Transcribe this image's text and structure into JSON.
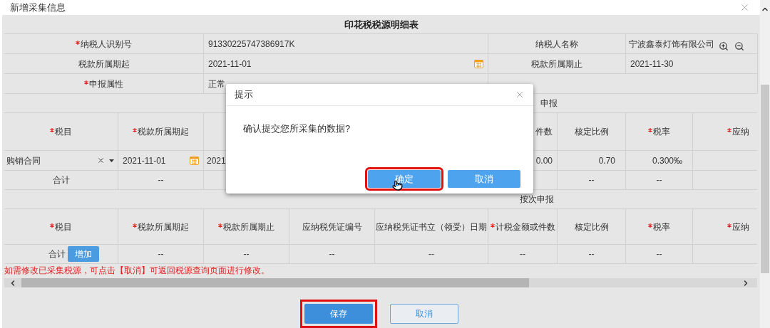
{
  "window": {
    "title": "新增采集信息"
  },
  "info": {
    "title": "印花税税源明细表",
    "rows": [
      {
        "cells": [
          {
            "kind": "label",
            "text": "纳税人识别号",
            "required": true
          },
          {
            "kind": "text",
            "text": "91330225747386917K"
          },
          {
            "kind": "label",
            "text": "纳税人名称",
            "required": false
          },
          {
            "kind": "zoom",
            "text": "宁波鑫泰灯饰有限公司"
          }
        ]
      },
      {
        "cells": [
          {
            "kind": "label",
            "text": "税款所属期起",
            "required": false
          },
          {
            "kind": "date",
            "text": "2021-11-01"
          },
          {
            "kind": "label",
            "text": "税款所属期止",
            "required": false
          },
          {
            "kind": "text",
            "text": "2021-11-30"
          }
        ]
      },
      {
        "cells": [
          {
            "kind": "label",
            "text": "申报属性",
            "required": true
          },
          {
            "kind": "text",
            "text": "正常"
          },
          {
            "kind": "empty"
          }
        ]
      }
    ]
  },
  "tables": [
    {
      "heading": "申报",
      "columns": [
        {
          "label": "税目",
          "required": true
        },
        {
          "label": "税款所属期起",
          "required": true
        },
        {},
        {},
        {},
        {
          "label": "件数",
          "required": false
        },
        {
          "label": "核定比例",
          "required": false
        },
        {
          "label": "税率",
          "required": true
        },
        {
          "label": "应纳",
          "required": true
        }
      ],
      "rows": [
        {
          "cells": [
            {
              "kind": "select",
              "text": "购销合同"
            },
            {
              "kind": "date",
              "text": "2021-11-01"
            },
            {
              "kind": "text",
              "text": "2021"
            },
            {},
            {},
            {
              "kind": "input",
              "text": "0.00"
            },
            {
              "kind": "number",
              "text": "0.70"
            },
            {
              "kind": "number",
              "text": "0.300‰"
            },
            {}
          ]
        },
        {
          "cells": [
            {
              "kind": "center",
              "text": "合计"
            },
            {
              "kind": "center",
              "text": "--"
            },
            {},
            {},
            {},
            {},
            {
              "kind": "center",
              "text": "--"
            },
            {
              "kind": "center",
              "text": "--"
            },
            {}
          ]
        }
      ]
    },
    {
      "heading": "按次申报",
      "columns": [
        {
          "label": "税目",
          "required": true
        },
        {
          "label": "税款所属期起",
          "required": true
        },
        {
          "label": "税款所属期止",
          "required": true
        },
        {
          "label": "应纳税凭证编号",
          "required": false
        },
        {
          "label": "应纳税凭证书立（领受）日期",
          "required": false
        },
        {
          "label": "计税金额或件数",
          "required": true
        },
        {
          "label": "核定比例",
          "required": false
        },
        {
          "label": "税率",
          "required": true
        },
        {
          "label": "应纳",
          "required": true
        }
      ],
      "rows": [
        {
          "cells": [
            {
              "kind": "total_add",
              "text": "合计",
              "button": "增加"
            },
            {
              "kind": "center",
              "text": "--"
            },
            {
              "kind": "center",
              "text": "--"
            },
            {
              "kind": "center",
              "text": "--"
            },
            {
              "kind": "center",
              "text": "--"
            },
            {
              "kind": "center",
              "text": "--"
            },
            {
              "kind": "center",
              "text": "--"
            },
            {
              "kind": "center",
              "text": "--"
            },
            {}
          ]
        }
      ]
    }
  ],
  "note": "如需修改已采集税源，可点击【取消】可返回税源查询页面进行修改。",
  "footer_buttons": [
    {
      "label": "保存",
      "kind": "primary",
      "highlighted": true
    },
    {
      "label": "取消",
      "kind": "secondary",
      "highlighted": false
    }
  ],
  "dialog": {
    "title": "提示",
    "message": "确认提交您所采集的数据?",
    "buttons": [
      {
        "label": "确定",
        "highlighted": true
      },
      {
        "label": "取消",
        "highlighted": false
      }
    ]
  }
}
